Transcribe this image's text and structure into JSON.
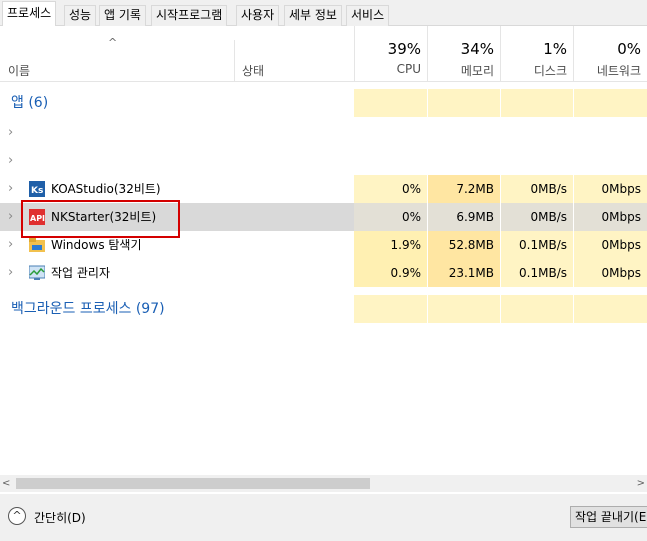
{
  "tabs": [
    "프로세스",
    "성능",
    "앱 기록",
    "시작프로그램",
    "사용자",
    "세부 정보",
    "서비스"
  ],
  "header": {
    "name_label": "이름",
    "status_label": "상태",
    "cpu": {
      "percent": "39%",
      "label": "CPU"
    },
    "memory": {
      "percent": "34%",
      "label": "메모리"
    },
    "disk": {
      "percent": "1%",
      "label": "디스크"
    },
    "network": {
      "percent": "0%",
      "label": "네트워크"
    }
  },
  "apps_group": {
    "title": "앱 (6)"
  },
  "processes": [
    {
      "name": "KOAStudio(32비트)",
      "cpu": "0%",
      "memory": "7.2MB",
      "disk": "0MB/s",
      "network": "0Mbps"
    },
    {
      "name": "NKStarter(32비트)",
      "cpu": "0%",
      "memory": "6.9MB",
      "disk": "0MB/s",
      "network": "0Mbps"
    },
    {
      "name": "Windows 탐색기",
      "cpu": "1.9%",
      "memory": "52.8MB",
      "disk": "0.1MB/s",
      "network": "0Mbps"
    },
    {
      "name": "작업 관리자",
      "cpu": "0.9%",
      "memory": "23.1MB",
      "disk": "0.1MB/s",
      "network": "0Mbps"
    }
  ],
  "background_group": {
    "title": "백그라운드 프로세스 (97)"
  },
  "footer": {
    "collapse_label": "간단히(D)",
    "end_task_label": "작업 끝내기(E)"
  },
  "colors": {
    "accent": "#1a5fb4",
    "highlight": "#d40000"
  }
}
